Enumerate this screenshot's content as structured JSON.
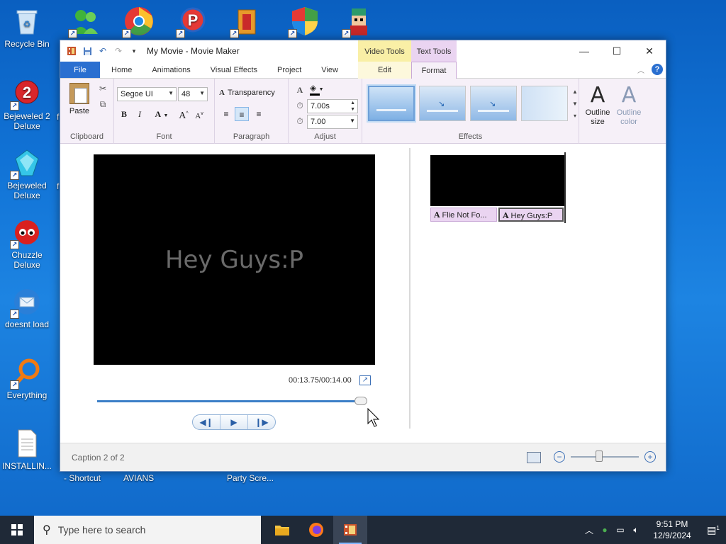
{
  "desktop": {
    "icons": [
      {
        "label": "Recycle Bin"
      },
      {
        "label": "Bejeweled 2 Deluxe"
      },
      {
        "label": "Bejeweled Deluxe"
      },
      {
        "label": "Chuzzle Deluxe"
      },
      {
        "label": "doesnt load"
      },
      {
        "label": "Everything"
      },
      {
        "label": "INSTALLIN..."
      }
    ],
    "behind_labels": [
      "f",
      "f",
      "- Shortcut",
      "AVIANS",
      "Party Scre..."
    ]
  },
  "window": {
    "title": "My Movie - Movie Maker",
    "context_groups": {
      "video_tools": "Video Tools",
      "text_tools": "Text Tools"
    },
    "tabs": [
      "File",
      "Home",
      "Animations",
      "Visual Effects",
      "Project",
      "View"
    ],
    "context_tabs": {
      "edit": "Edit",
      "format": "Format"
    },
    "help_label": "?",
    "controls": {
      "minimize": "—",
      "maximize": "☐",
      "close": "✕"
    }
  },
  "ribbon": {
    "clipboard": {
      "label": "Clipboard",
      "paste": "Paste"
    },
    "font": {
      "label": "Font",
      "family": "Segoe UI",
      "size": "48",
      "bold": "B",
      "italic": "I",
      "color": "A",
      "grow": "A",
      "shrink": "A"
    },
    "paragraph": {
      "label": "Paragraph",
      "transparency": "Transparency"
    },
    "adjust": {
      "label": "Adjust",
      "start_time": "7.00s",
      "duration": "7.00"
    },
    "effects": {
      "label": "Effects",
      "outline_size": "Outline size",
      "outline_color": "Outline color",
      "letter": "A"
    }
  },
  "preview": {
    "caption_text": "Hey Guys:P",
    "time": "00:13.75/00:14.00",
    "progress": 0.982
  },
  "storyboard": {
    "captions": [
      "Flie Not Fo...",
      "Hey Guys:P"
    ]
  },
  "status": {
    "text": "Caption 2 of 2",
    "zoom_level": 0.42
  },
  "taskbar": {
    "search_placeholder": "Type here to search",
    "time": "9:51 PM",
    "date": "12/9/2024",
    "notification_count": "1"
  },
  "colors": {
    "file_tab": "#2a6fd0",
    "video_tools": "#f9efa6",
    "text_tools": "#ead4f1",
    "taskbar": "#1f2937"
  }
}
